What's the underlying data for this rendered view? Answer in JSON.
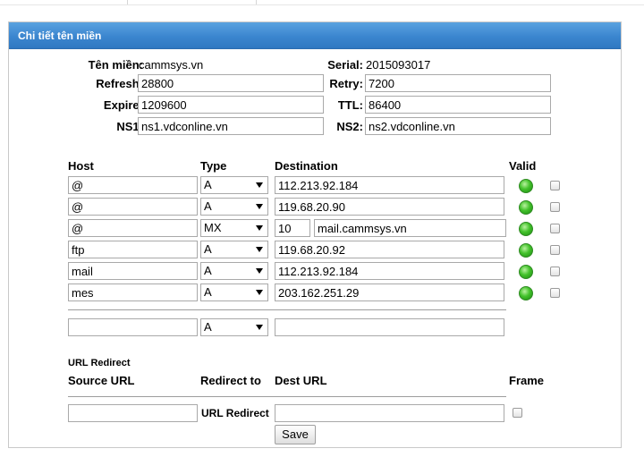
{
  "panel": {
    "title": "Chi tiết tên miền"
  },
  "zone": {
    "domain_label": "Tên miền:",
    "domain_value": "cammsys.vn",
    "serial_label": "Serial:",
    "serial_value": "2015093017",
    "refresh_label": "Refresh:",
    "refresh_value": "28800",
    "retry_label": "Retry:",
    "retry_value": "7200",
    "expire_label": "Expire:",
    "expire_value": "1209600",
    "ttl_label": "TTL:",
    "ttl_value": "86400",
    "ns1_label": "NS1:",
    "ns1_value": "ns1.vdconline.vn",
    "ns2_label": "NS2:",
    "ns2_value": "ns2.vdconline.vn"
  },
  "records_headers": {
    "host": "Host",
    "type": "Type",
    "destination": "Destination",
    "valid": "Valid"
  },
  "records": [
    {
      "host": "@",
      "type": "A",
      "destination": "112.213.92.184"
    },
    {
      "host": "@",
      "type": "A",
      "destination": "119.68.20.90"
    },
    {
      "host": "@",
      "type": "MX",
      "priority": "10",
      "destination": "mail.cammsys.vn"
    },
    {
      "host": "ftp",
      "type": "A",
      "destination": "119.68.20.92"
    },
    {
      "host": "mail",
      "type": "A",
      "destination": "112.213.92.184"
    },
    {
      "host": "mes",
      "type": "A",
      "destination": "203.162.251.29"
    }
  ],
  "new_record": {
    "host": "",
    "type": "A",
    "destination": ""
  },
  "url_redirect": {
    "section_title": "URL Redirect",
    "source_header": "Source URL",
    "redirect_header": "Redirect to",
    "dest_header": "Dest URL",
    "frame_header": "Frame",
    "redirect_label": "URL Redirect",
    "source_value": "",
    "dest_value": ""
  },
  "actions": {
    "save_label": "Save"
  },
  "colors": {
    "header_blue": "#3b86cf",
    "valid_green": "#43c22b"
  }
}
